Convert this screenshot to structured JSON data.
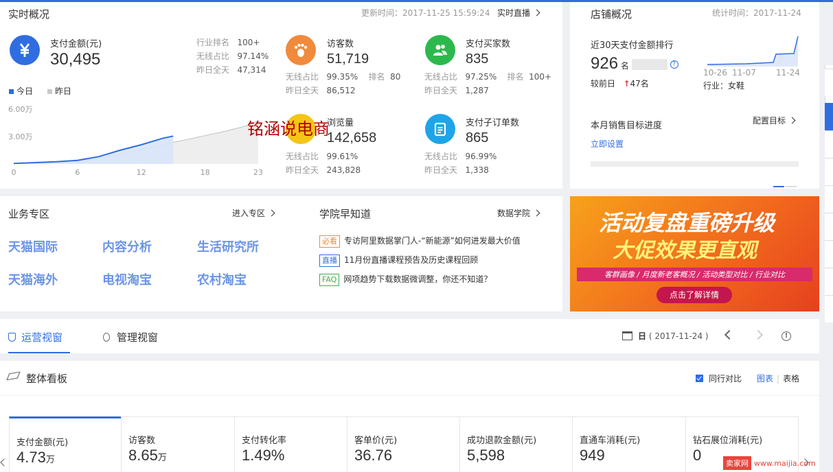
{
  "realtime": {
    "title": "实时概况",
    "update_time": "更新时间：2017-11-25 15:59:24",
    "live_link": "实时直播",
    "pay_amount": {
      "label": "支付金额(元)",
      "value": "30,495",
      "rank_label": "行业排名",
      "rank": "100+",
      "wireless_label": "无线占比",
      "wireless": "97.14%",
      "yesterday_label": "昨日全天",
      "yesterday": "47,314"
    },
    "legend_today": "今日",
    "legend_yesterday": "昨日",
    "visitors": {
      "label": "访客数",
      "value": "51,719",
      "wireless_label": "无线占比",
      "wireless": "99.35%",
      "rank_label": "排名",
      "rank": "80",
      "yesterday_label": "昨日全天",
      "yesterday": "86,512"
    },
    "buyers": {
      "label": "支付买家数",
      "value": "835",
      "wireless_label": "无线占比",
      "wireless": "97.25%",
      "rank_label": "排名",
      "rank": "100+",
      "yesterday_label": "昨日全天",
      "yesterday": "1,287"
    },
    "pageviews": {
      "label": "浏览量",
      "value": "142,658",
      "wireless_label": "无线占比",
      "wireless": "99.61%",
      "yesterday_label": "昨日全天",
      "yesterday": "243,828"
    },
    "sub_orders": {
      "label": "支付子订单数",
      "value": "865",
      "wireless_label": "无线占比",
      "wireless": "96.99%",
      "yesterday_label": "昨日全天",
      "yesterday": "1,338"
    },
    "watermark": "铭涵说电商"
  },
  "chart_data": {
    "type": "area",
    "x_ticks": [
      "0",
      "6",
      "12",
      "18",
      "23"
    ],
    "y_ticks": [
      "6.00万",
      "3.00万"
    ],
    "ylim": [
      0,
      60000
    ],
    "series": [
      {
        "name": "今日",
        "color": "#2f6de1",
        "x": [
          0,
          2,
          4,
          6,
          8,
          10,
          12,
          14,
          15
        ],
        "y": [
          500,
          1500,
          2500,
          4000,
          8000,
          15000,
          21000,
          28000,
          30495
        ]
      },
      {
        "name": "昨日",
        "color": "#c8c8c8",
        "x": [
          0,
          2,
          4,
          6,
          8,
          10,
          12,
          14,
          16,
          18,
          20,
          22,
          23
        ],
        "y": [
          500,
          1200,
          2000,
          3500,
          6000,
          11000,
          16000,
          21000,
          26000,
          31000,
          36000,
          42000,
          47314
        ]
      }
    ]
  },
  "shop": {
    "title": "店铺概况",
    "stat_time": "统计时间：2017-11-24",
    "rank_title": "近30天支付金额排行",
    "rank_value": "926",
    "rank_unit": "名",
    "compare_label": "较前日",
    "compare_value": "47名",
    "chart_ticks": [
      "10-26",
      "11-07",
      "11-24"
    ],
    "industry": "行业：女鞋",
    "target_title": "本月销售目标进度",
    "target_config": "配置目标",
    "set_now": "立即设置"
  },
  "business": {
    "title": "业务专区",
    "enter": "进入专区",
    "items": [
      "天猫国际",
      "内容分析",
      "生活研究所",
      "天猫海外",
      "电视淘宝",
      "农村淘宝"
    ]
  },
  "academy": {
    "title": "学院早知道",
    "link": "数据学院",
    "news": [
      {
        "tag": "必看",
        "tag_color": "#f08a3c",
        "text": "专访阿里数据掌门人-“新能源”如何进发最大价值"
      },
      {
        "tag": "直播",
        "tag_color": "#2f6de1",
        "text": "11月份直播课程预告及历史课程回顾"
      },
      {
        "tag": "FAQ",
        "tag_color": "#3bb04c",
        "text": "网项趋势下载数据微调整，你还不知道？"
      }
    ]
  },
  "banner": {
    "line1": "活动复盘重磅升级",
    "line2": "大促效果更直观",
    "line3": "客群画像 / 月度新老客概况 / 活动类型对比 / 行业对比",
    "button": "点击了解详情"
  },
  "views": {
    "tab_ops": "运营视窗",
    "tab_mgmt": "管理视窗",
    "date_prefix": "日",
    "date": "( 2017-11-24 )"
  },
  "board": {
    "title": "整体看板",
    "compare_label": "同行对比",
    "chart_link": "图表",
    "table_link": "表格",
    "kpis": [
      {
        "label": "支付金额(元)",
        "value": "4.73",
        "unit": "万"
      },
      {
        "label": "访客数",
        "value": "8.65",
        "unit": "万"
      },
      {
        "label": "支付转化率",
        "value": "1.49%",
        "unit": ""
      },
      {
        "label": "客单价(元)",
        "value": "36.76",
        "unit": ""
      },
      {
        "label": "成功退款金额(元)",
        "value": "5,598",
        "unit": ""
      },
      {
        "label": "直通车消耗(元)",
        "value": "949",
        "unit": ""
      },
      {
        "label": "钻石展位消耗(元)",
        "value": "0",
        "unit": ""
      }
    ]
  },
  "footer_watermark": {
    "badge": "卖家网",
    "url": "www.maijia.com"
  }
}
